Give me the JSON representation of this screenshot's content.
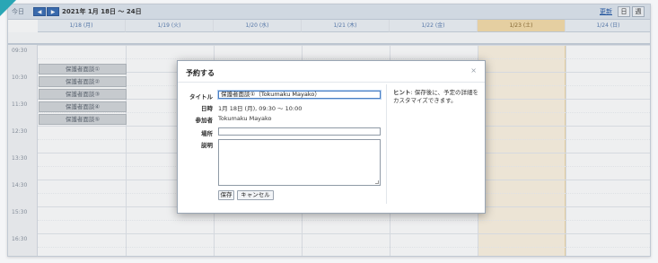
{
  "toolbar": {
    "today_label": "今日",
    "prev_label": "◀",
    "next_label": "▶",
    "range_label": "2021年 1月 18日 ～ 24日",
    "refresh_label": "更新",
    "view_day_label": "日",
    "view_week_label": "週"
  },
  "days": [
    {
      "label": "1/18 (月)"
    },
    {
      "label": "1/19 (火)"
    },
    {
      "label": "1/20 (水)"
    },
    {
      "label": "1/21 (木)"
    },
    {
      "label": "1/22 (金)"
    },
    {
      "label": "1/23 (土)"
    },
    {
      "label": "1/24 (日)"
    }
  ],
  "times": [
    "09:30",
    "10:30",
    "11:30",
    "12:30",
    "13:30",
    "14:30",
    "15:30",
    "16:30"
  ],
  "slots": [
    "保護者面談①",
    "保護者面談②",
    "保護者面談③",
    "保護者面談④",
    "保護者面談⑤"
  ],
  "dialog": {
    "title": "予約する",
    "close_label": "×",
    "title_label": "タイトル",
    "title_value": "保護者面談①（Tokumaku Mayako）",
    "datetime_label": "日時",
    "datetime_value": "1月 18日 (月), 09:30 ～ 10:00",
    "attendee_label": "参加者",
    "attendee_value": "Tokumaku Mayako",
    "place_label": "場所",
    "place_value": "",
    "desc_label": "説明",
    "desc_value": "",
    "save_label": "保存",
    "cancel_label": "キャンセル",
    "hint_title": "ヒント",
    "hint_text": ": 保存後に、予定の詳細をカスタマイズできます。"
  },
  "colors": {
    "accent": "#3b6fb6",
    "saturday": "#f6ddaa",
    "slot_bg": "#d4d7db"
  }
}
